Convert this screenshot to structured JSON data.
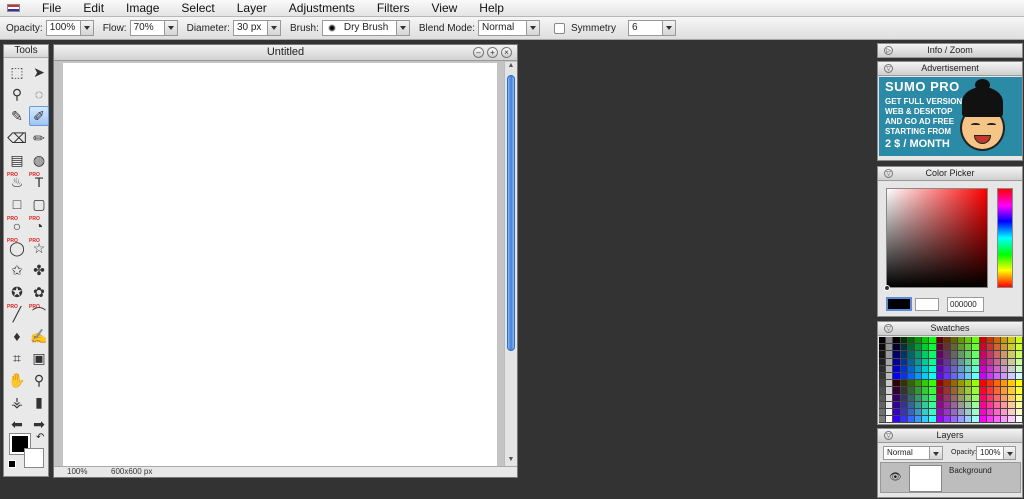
{
  "menu": [
    "File",
    "Edit",
    "Image",
    "Select",
    "Layer",
    "Adjustments",
    "Filters",
    "View",
    "Help"
  ],
  "options": {
    "opacity_label": "Opacity:",
    "opacity_value": "100%",
    "flow_label": "Flow:",
    "flow_value": "70%",
    "diameter_label": "Diameter:",
    "diameter_value": "30 px",
    "brush_label": "Brush:",
    "brush_value": "Dry Brush",
    "blend_label": "Blend Mode:",
    "blend_value": "Normal",
    "symmetry_label": "Symmetry",
    "symmetry_value": "6"
  },
  "tools": {
    "title": "Tools",
    "items": [
      {
        "name": "marquee-tool",
        "glyph": "⬚",
        "sel": false,
        "pro": false
      },
      {
        "name": "move-tool",
        "glyph": "➤",
        "sel": false,
        "pro": false
      },
      {
        "name": "wand-tool",
        "glyph": "⚲",
        "sel": false,
        "pro": false
      },
      {
        "name": "lasso-tool",
        "glyph": "◌",
        "sel": false,
        "pro": false
      },
      {
        "name": "brush-tool",
        "glyph": "✎",
        "sel": false,
        "pro": false
      },
      {
        "name": "dry-brush-tool",
        "glyph": "✐",
        "sel": true,
        "pro": false
      },
      {
        "name": "eraser-tool",
        "glyph": "⌫",
        "sel": false,
        "pro": false
      },
      {
        "name": "pencil-tool",
        "glyph": "✏",
        "sel": false,
        "pro": false
      },
      {
        "name": "gradient-tool",
        "glyph": "▤",
        "sel": false,
        "pro": false
      },
      {
        "name": "fill-tool",
        "glyph": "◍",
        "sel": false,
        "pro": false
      },
      {
        "name": "stamp-tool",
        "glyph": "♨",
        "sel": false,
        "pro": true
      },
      {
        "name": "text-tool",
        "glyph": "T",
        "sel": false,
        "pro": true
      },
      {
        "name": "rect-tool",
        "glyph": "□",
        "sel": false,
        "pro": false
      },
      {
        "name": "rounded-rect-tool",
        "glyph": "▢",
        "sel": false,
        "pro": false
      },
      {
        "name": "ellipse-tool",
        "glyph": "○",
        "sel": false,
        "pro": true
      },
      {
        "name": "shape-tool",
        "glyph": "◔",
        "sel": false,
        "pro": true
      },
      {
        "name": "circle-tool",
        "glyph": "◯",
        "sel": false,
        "pro": true
      },
      {
        "name": "star-outline-tool",
        "glyph": "☆",
        "sel": false,
        "pro": true
      },
      {
        "name": "star-tool",
        "glyph": "✩",
        "sel": false,
        "pro": false
      },
      {
        "name": "puzzle-tool",
        "glyph": "✤",
        "sel": false,
        "pro": false
      },
      {
        "name": "blob-tool",
        "glyph": "✪",
        "sel": false,
        "pro": false
      },
      {
        "name": "flower-tool",
        "glyph": "✿",
        "sel": false,
        "pro": false
      },
      {
        "name": "line-tool",
        "glyph": "╱",
        "sel": false,
        "pro": true
      },
      {
        "name": "curve-tool",
        "glyph": "⌒",
        "sel": false,
        "pro": true
      },
      {
        "name": "drop-tool",
        "glyph": "♦",
        "sel": false,
        "pro": false
      },
      {
        "name": "smudge-tool",
        "glyph": "✍",
        "sel": false,
        "pro": false
      },
      {
        "name": "crop-tool",
        "glyph": "⌗",
        "sel": false,
        "pro": false
      },
      {
        "name": "resize-tool",
        "glyph": "▣",
        "sel": false,
        "pro": false
      },
      {
        "name": "hand-tool",
        "glyph": "✋",
        "sel": false,
        "pro": false
      },
      {
        "name": "zoom-tool",
        "glyph": "⚲",
        "sel": false,
        "pro": false
      },
      {
        "name": "eyedropper-tool",
        "glyph": "⚶",
        "sel": false,
        "pro": false
      },
      {
        "name": "cylinder-tool",
        "glyph": "▮",
        "sel": false,
        "pro": false
      },
      {
        "name": "arrow-left-tool",
        "glyph": "⬅",
        "sel": false,
        "pro": false
      },
      {
        "name": "arrow-right-tool",
        "glyph": "➡",
        "sel": false,
        "pro": false
      }
    ]
  },
  "document": {
    "title": "Untitled",
    "zoom": "100%",
    "size": "600x600 px"
  },
  "panels": {
    "info": "Info / Zoom",
    "ad_title": "Advertisement",
    "color_picker": "Color Picker",
    "swatches": "Swatches",
    "layers": "Layers"
  },
  "ad": {
    "title": "SUMO PRO",
    "lines": [
      "GET FULL VERSION",
      "WEB & DESKTOP",
      "AND GO AD FREE",
      "STARTING FROM"
    ],
    "price": "2 $ / MONTH"
  },
  "color": {
    "hex": "000000",
    "foreground": "#000000",
    "background": "#ffffff"
  },
  "layers": {
    "blend": "Normal",
    "opacity_label": "Opacity:",
    "opacity": "100%",
    "items": [
      {
        "name": "Background"
      }
    ]
  }
}
